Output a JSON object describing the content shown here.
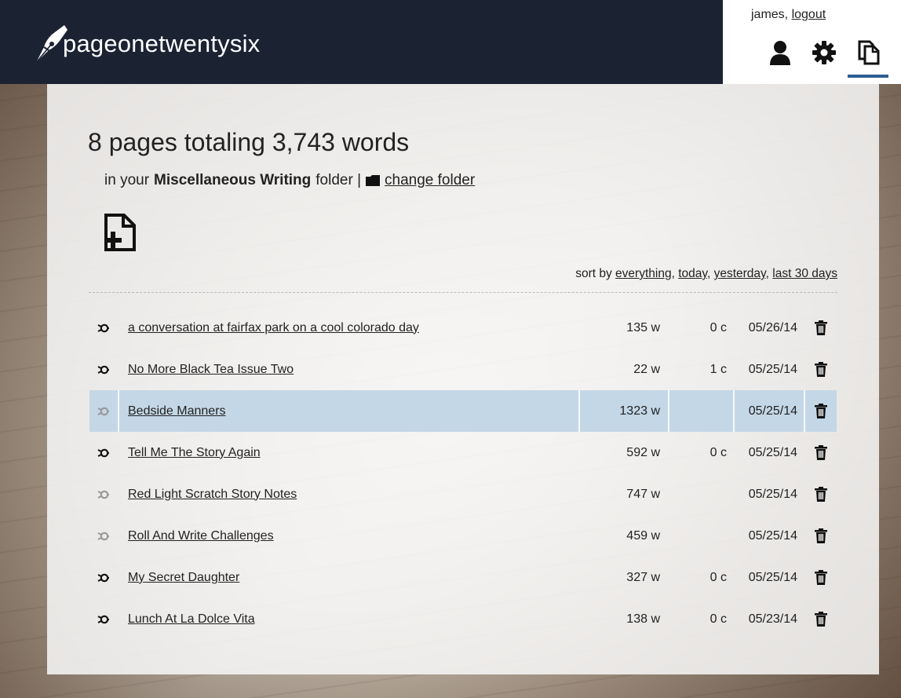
{
  "header": {
    "logo_text": "pageonetwentysix",
    "username": "james,",
    "logout_label": "logout",
    "colors": {
      "topbar": "#1b2333",
      "accent": "#2a5e93"
    }
  },
  "nav": {
    "items": [
      {
        "icon": "user-icon"
      },
      {
        "icon": "gear-icon"
      },
      {
        "icon": "pages-icon",
        "active": true
      }
    ]
  },
  "main": {
    "headline": "8 pages totaling 3,743 words",
    "folder_prefix": "in your",
    "folder_name": "Miscellaneous Writing",
    "folder_suffix": "folder |",
    "change_folder_label": "change folder",
    "sort": {
      "prefix": "sort by",
      "options": [
        "everything",
        "today",
        "yesterday",
        "last 30 days"
      ]
    },
    "pages": [
      {
        "title": "a conversation at fairfax park on a cool colorado day",
        "words": "135 w",
        "comments": "0 c",
        "date": "05/26/14",
        "shared": true
      },
      {
        "title": "No More Black Tea Issue Two",
        "words": "22 w",
        "comments": "1 c",
        "date": "05/25/14",
        "shared": true
      },
      {
        "title": "Bedside Manners",
        "words": "1323 w",
        "comments": "",
        "date": "05/25/14",
        "shared": false,
        "highlighted": true
      },
      {
        "title": "Tell Me The Story Again",
        "words": "592 w",
        "comments": "0 c",
        "date": "05/25/14",
        "shared": true
      },
      {
        "title": "Red Light Scratch Story Notes",
        "words": "747 w",
        "comments": "",
        "date": "05/25/14",
        "shared": false
      },
      {
        "title": "Roll And Write Challenges",
        "words": "459 w",
        "comments": "",
        "date": "05/25/14",
        "shared": false
      },
      {
        "title": "My Secret Daughter",
        "words": "327 w",
        "comments": "0 c",
        "date": "05/25/14",
        "shared": true
      },
      {
        "title": "Lunch At La Dolce Vita",
        "words": "138 w",
        "comments": "0 c",
        "date": "05/23/14",
        "shared": true
      }
    ]
  }
}
